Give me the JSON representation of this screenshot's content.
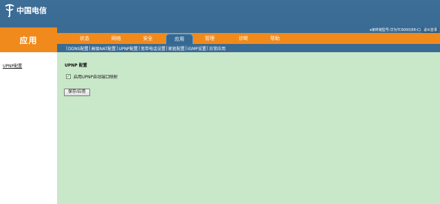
{
  "logo": {
    "text": "中国电信"
  },
  "header": {
    "device_info": "e家终端型号:华为TC6000(E8-C)",
    "logout_label": "退出登录"
  },
  "section": {
    "title": "应用"
  },
  "menu": {
    "items": [
      {
        "label": "状态",
        "active": false
      },
      {
        "label": "网络",
        "active": false
      },
      {
        "label": "安全",
        "active": false
      },
      {
        "label": "应用",
        "active": true
      },
      {
        "label": "管理",
        "active": false
      },
      {
        "label": "诊断",
        "active": false
      },
      {
        "label": "帮助",
        "active": false
      }
    ]
  },
  "submenu": {
    "items": [
      {
        "label": "DDNS配置"
      },
      {
        "label": "高级NAT配置"
      },
      {
        "label": "UPNP配置"
      },
      {
        "label": "宽带电话设置"
      },
      {
        "label": "家庭配置"
      },
      {
        "label": "IGMP设置"
      },
      {
        "label": "日常应用"
      }
    ]
  },
  "sidebar": {
    "items": [
      {
        "label": "UPNP配置"
      }
    ]
  },
  "main": {
    "title": "UPNP 配置",
    "checkbox_label": "启用UPNP自动端口映射",
    "checkbox_checked": true,
    "save_button": "保存/应用"
  }
}
